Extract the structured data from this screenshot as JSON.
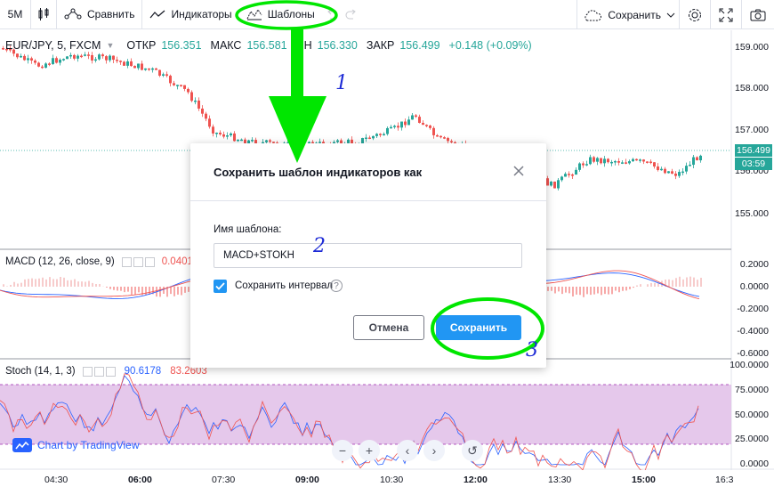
{
  "toolbar": {
    "interval": "5M",
    "compare_label": "Сравнить",
    "indicators_label": "Индикаторы",
    "templates_label": "Шаблоны",
    "save_label": "Сохранить"
  },
  "legend": {
    "symbol": "EUR/JPY, 5, FXCM",
    "open_key": "ОТКР",
    "open_val": "156.351",
    "high_key": "МАКС",
    "high_val": "156.581",
    "low_key": "ИН",
    "low_val": "156.330",
    "close_key": "ЗАКР",
    "close_val": "156.499",
    "change": "+0.148 (+0.09%)"
  },
  "price_axis": {
    "main": [
      "159.000",
      "158.000",
      "157.000",
      "155.000"
    ],
    "main_last_partial": "156.000",
    "last_price": "156.499",
    "countdown": "03:59",
    "macd": [
      "0.2000",
      "0.0000",
      "-0.2000",
      "-0.4000",
      "-0.6000"
    ],
    "stoch": [
      "100.0000",
      "75.0000",
      "50.0000",
      "25.0000",
      "0.0000"
    ]
  },
  "time_axis": [
    {
      "t": "04:30",
      "bold": false
    },
    {
      "t": "06:00",
      "bold": true
    },
    {
      "t": "07:30",
      "bold": false
    },
    {
      "t": "09:00",
      "bold": true
    },
    {
      "t": "10:30",
      "bold": false
    },
    {
      "t": "12:00",
      "bold": true
    },
    {
      "t": "13:30",
      "bold": false
    },
    {
      "t": "15:00",
      "bold": true
    },
    {
      "t": "16:3",
      "bold": false
    }
  ],
  "macd": {
    "title": "MACD (12, 26, close, 9)",
    "value": "0.0401"
  },
  "stoch": {
    "title": "Stoch (14, 1, 3)",
    "k": "90.6178",
    "d": "83.2603"
  },
  "branding": "Chart by TradingView",
  "modal": {
    "title": "Сохранить шаблон индикаторов как",
    "name_label": "Имя шаблона:",
    "name_value": "MACD+STOKH",
    "save_interval_label": "Сохранить интервал",
    "save_interval_checked": true,
    "cancel_label": "Отмена",
    "save_label": "Сохранить"
  },
  "annotations": {
    "one": "1",
    "two": "2",
    "three": "3"
  },
  "colors": {
    "up": "#26a69a",
    "down": "#ef5350",
    "accent": "#2196f3",
    "highlight": "#00e600",
    "stoch_band": "#e1bee7",
    "annotation": "#1e2bd6"
  },
  "icons": {
    "compare": "compare-icon",
    "indicators": "indicators-icon",
    "templates": "templates-icon",
    "undo": "undo-icon",
    "redo": "redo-icon",
    "cloud": "cloud-icon",
    "settings": "gear-icon",
    "fullscreen": "fullscreen-icon",
    "snapshot": "camera-icon"
  }
}
